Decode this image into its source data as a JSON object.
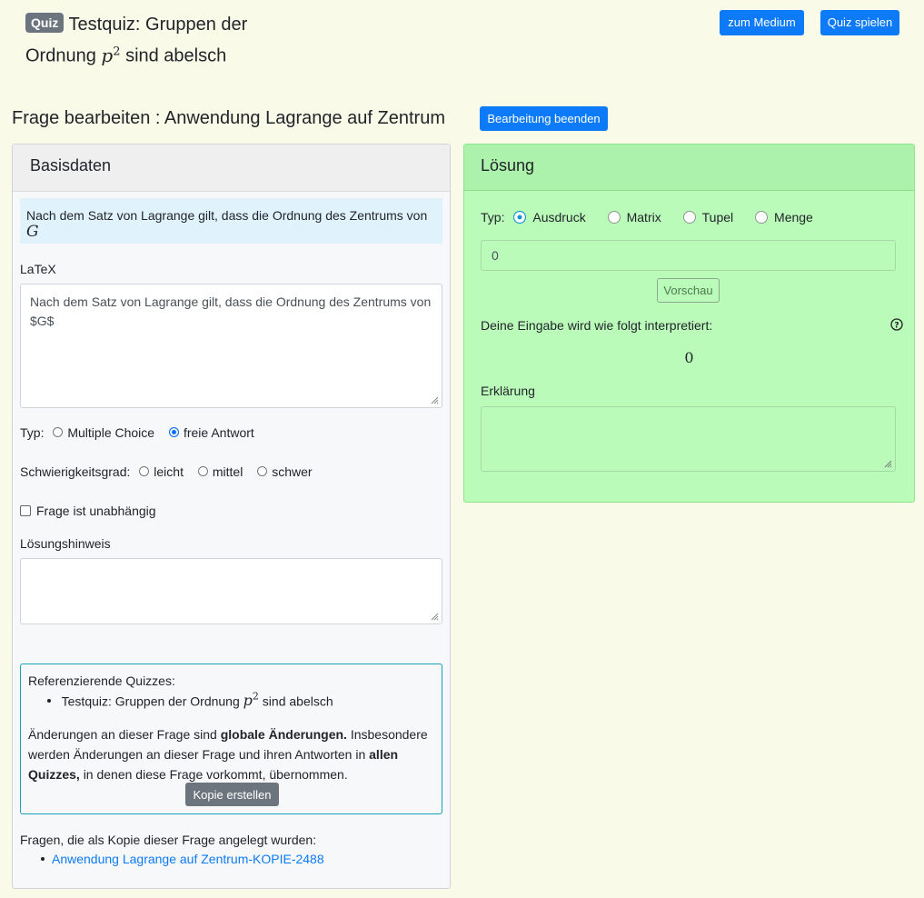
{
  "header": {
    "badge": "Quiz",
    "title_prefix": "Testquiz: Gruppen der",
    "title_line2_a": "Ordnung",
    "title_math": "p",
    "title_sup": "2",
    "title_line2_b": "sind abelsch",
    "btn_medium": "zum Medium",
    "btn_play": "Quiz spielen"
  },
  "question": {
    "heading": "Frage bearbeiten : Anwendung Lagrange auf Zentrum",
    "btn_finish": "Bearbeitung beenden"
  },
  "basis": {
    "title": "Basisdaten",
    "preview_text": "Nach dem Satz von Lagrange gilt, dass die Ordnung des Zentrums von",
    "preview_math": "G",
    "latex_label": "LaTeX",
    "latex_value": "Nach dem Satz von Lagrange gilt, dass die Ordnung des Zentrums von $G$",
    "type_label": "Typ:",
    "type_options": [
      "Multiple Choice",
      "freie Antwort"
    ],
    "type_selected": "freie Antwort",
    "difficulty_label": "Schwierigkeitsgrad:",
    "difficulty_options": [
      "leicht",
      "mittel",
      "schwer"
    ],
    "independent_label": "Frage ist unabhängig",
    "independent_checked": false,
    "hint_label": "Lösungshinweis",
    "hint_value": "",
    "ref_title": "Referenzierende Quizzes:",
    "ref_item_a": "Testquiz: Gruppen der Ordnung",
    "ref_item_math": "p",
    "ref_item_sup": "2",
    "ref_item_b": "sind abelsch",
    "warn_1": "Änderungen an dieser Frage sind",
    "warn_bold_1": "globale Änderungen.",
    "warn_2": "Insbesondere werden Änderungen an dieser Frage und ihren Antworten in",
    "warn_bold_2": "allen Quizzes,",
    "warn_3": "in denen diese Frage vorkommt, übernommen.",
    "copy_button": "Kopie erstellen",
    "copies_label": "Fragen, die als Kopie dieser Frage angelegt wurden:",
    "copies": [
      "Anwendung Lagrange auf Zentrum-KOPIE-2488"
    ]
  },
  "solution": {
    "title": "Lösung",
    "type_label": "Typ:",
    "type_options": [
      "Ausdruck",
      "Matrix",
      "Tupel",
      "Menge"
    ],
    "type_selected": "Ausdruck",
    "input_value": "0",
    "preview_button": "Vorschau",
    "interpret_label": "Deine Eingabe wird wie folgt interpretiert:",
    "interpret_value": "0",
    "help_icon": "question-circle-icon",
    "explanation_label": "Erklärung",
    "explanation_value": ""
  },
  "colors": {
    "page_bg": "#fafae8",
    "primary": "#0d7bf7",
    "solution_bg": "#bafbba",
    "info_bg": "#e0f3fd",
    "ref_border": "#17a2b8"
  }
}
